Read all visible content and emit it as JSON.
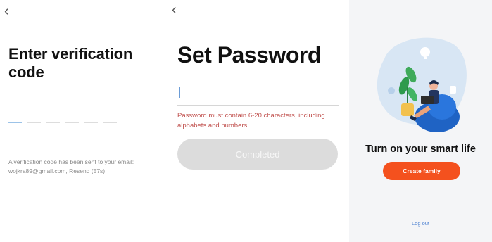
{
  "verification": {
    "back_label": "‹",
    "title": "Enter verification code",
    "code_slot_count": 6,
    "hint": "A verification code has been sent to your email: wojkra89@gmail.com, Resend (57s)"
  },
  "password": {
    "back_label": "‹",
    "title": "Set Password",
    "input_value": "",
    "hint": "Password must contain 6-20 characters, including alphabets and numbers",
    "completed_label": "Completed"
  },
  "smart_life": {
    "title": "Turn on your smart life",
    "create_family_label": "Create family",
    "logout_label": "Log out"
  },
  "colors": {
    "accent_orange": "#f4511e",
    "error_text": "#c0504d",
    "link_blue": "#4a7fd0",
    "disabled_button": "#dcdcdc"
  }
}
